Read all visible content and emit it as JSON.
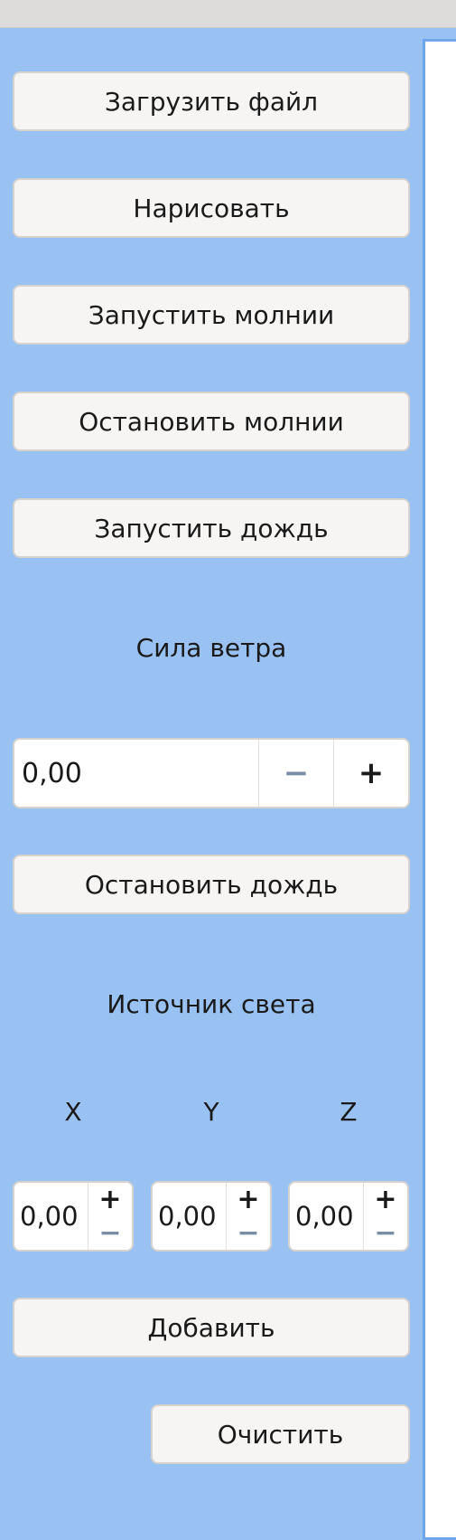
{
  "buttons": {
    "load_file": "Загрузить файл",
    "draw": "Нарисовать",
    "start_lightning": "Запустить молнии",
    "stop_lightning": "Остановить молнии",
    "start_rain": "Запустить дождь",
    "stop_rain": "Остановить дождь",
    "add": "Добавить",
    "clear": "Очистить"
  },
  "wind": {
    "label": "Сила ветра",
    "value": "0,00",
    "minus": "−",
    "plus": "+"
  },
  "light": {
    "label": "Источник света",
    "axes": [
      "X",
      "Y",
      "Z"
    ],
    "values": [
      "0,00",
      "0,00",
      "0,00"
    ],
    "plus": "+",
    "minus": "−"
  }
}
